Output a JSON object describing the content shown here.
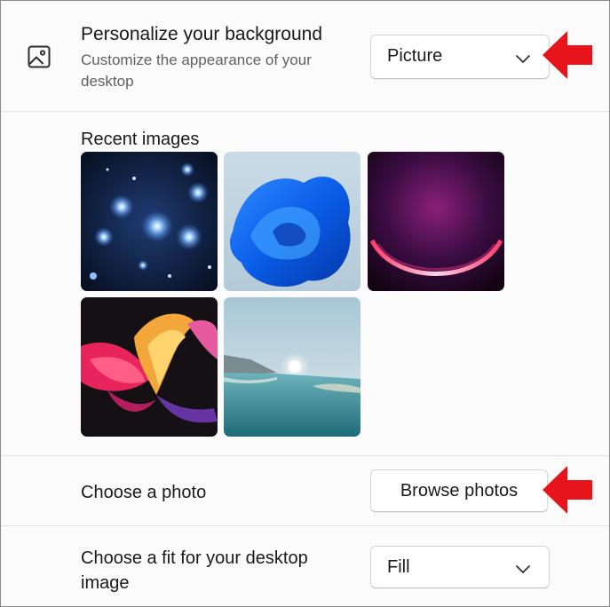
{
  "background": {
    "title": "Personalize your background",
    "subtitle": "Customize the appearance of your desktop",
    "icon": "picture-icon",
    "mode_dropdown": {
      "selected": "Picture",
      "icon": "chevron-down-icon"
    }
  },
  "recent": {
    "label": "Recent images"
  },
  "choose_photo": {
    "label": "Choose a photo",
    "button_label": "Browse photos"
  },
  "fit": {
    "label": "Choose a fit for your desktop image",
    "selected": "Fill",
    "icon": "chevron-down-icon"
  },
  "annotations": {
    "arrow_color": "#e8141c"
  }
}
